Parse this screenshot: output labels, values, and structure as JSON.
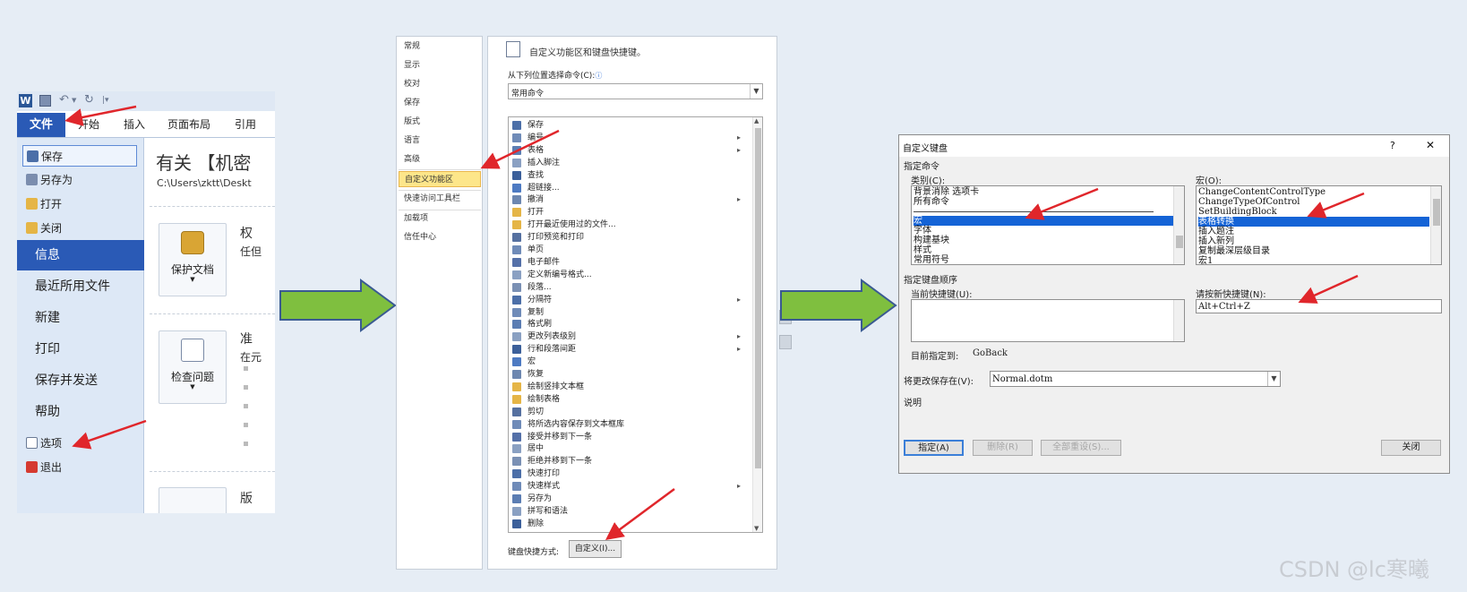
{
  "panel1": {
    "quick_access_icons": [
      "word-logo-icon",
      "save-icon",
      "undo-icon",
      "redo-icon",
      "customize-icon"
    ],
    "file_tab": "文件",
    "tabs": [
      "开始",
      "插入",
      "页面布局",
      "引用"
    ],
    "menu_small_top": [
      {
        "label": "保存",
        "icon": "save-icon"
      },
      {
        "label": "另存为",
        "icon": "save-as-icon"
      },
      {
        "label": "打开",
        "icon": "open-folder-icon"
      },
      {
        "label": "关闭",
        "icon": "close-folder-icon"
      }
    ],
    "menu_big": [
      "信息",
      "最近所用文件",
      "新建",
      "打印",
      "保存并发送",
      "帮助"
    ],
    "menu_small_bottom": [
      {
        "label": "选项",
        "icon": "options-icon"
      },
      {
        "label": "退出",
        "icon": "exit-icon"
      }
    ],
    "content_title": "有关 【机密",
    "content_path": "C:\\Users\\zktt\\Deskt",
    "section1_heading": "权",
    "section1_sub": "任但",
    "protect_label": "保护文档",
    "section2_heading": "准",
    "section2_sub": "在元",
    "check_label": "检查问题",
    "section3_heading": "版"
  },
  "panel2": {
    "nav": [
      "常规",
      "显示",
      "校对",
      "保存",
      "版式",
      "语言",
      "高级",
      "自定义功能区",
      "快速访问工具栏",
      "加载项",
      "信任中心"
    ],
    "selected_nav": "自定义功能区",
    "header": "自定义功能区和键盘快捷键。",
    "choose_label": "从下列位置选择命令(C):",
    "choose_value": "常用命令",
    "commands": [
      {
        "label": "保存",
        "sub": false
      },
      {
        "label": "编号",
        "sub": true
      },
      {
        "label": "表格",
        "sub": true
      },
      {
        "label": "插入脚注",
        "sub": false
      },
      {
        "label": "查找",
        "sub": false
      },
      {
        "label": "超链接...",
        "sub": false
      },
      {
        "label": "撤消",
        "sub": true
      },
      {
        "label": "打开",
        "sub": false
      },
      {
        "label": "打开最近使用过的文件...",
        "sub": false
      },
      {
        "label": "打印预览和打印",
        "sub": false
      },
      {
        "label": "单页",
        "sub": false
      },
      {
        "label": "电子邮件",
        "sub": false
      },
      {
        "label": "定义新编号格式...",
        "sub": false
      },
      {
        "label": "段落...",
        "sub": false
      },
      {
        "label": "分隔符",
        "sub": true
      },
      {
        "label": "复制",
        "sub": false
      },
      {
        "label": "格式刷",
        "sub": false
      },
      {
        "label": "更改列表级别",
        "sub": true
      },
      {
        "label": "行和段落间距",
        "sub": true
      },
      {
        "label": "宏",
        "sub": false
      },
      {
        "label": "恢复",
        "sub": false
      },
      {
        "label": "绘制竖排文本框",
        "sub": false
      },
      {
        "label": "绘制表格",
        "sub": false
      },
      {
        "label": "剪切",
        "sub": false
      },
      {
        "label": "将所选内容保存到文本框库",
        "sub": false
      },
      {
        "label": "接受并移到下一条",
        "sub": false
      },
      {
        "label": "居中",
        "sub": false
      },
      {
        "label": "拒绝并移到下一条",
        "sub": false
      },
      {
        "label": "快速打印",
        "sub": false
      },
      {
        "label": "快速样式",
        "sub": true
      },
      {
        "label": "另存为",
        "sub": false
      },
      {
        "label": "拼写和语法",
        "sub": false
      },
      {
        "label": "删除",
        "sub": false
      }
    ],
    "shortcut_label": "键盘快捷方式:",
    "customize_button": "自定义(I)..."
  },
  "panel3": {
    "title": "自定义键盘",
    "help": "?",
    "close_x": "✕",
    "group_commands": "指定命令",
    "category_label": "类别(C):",
    "categories": [
      "背景消除 选项卡",
      "所有命令",
      "",
      "宏",
      "字体",
      "构建基块",
      "样式",
      "常用符号"
    ],
    "category_selected": "宏",
    "macro_label": "宏(O):",
    "macros": [
      "ChangeContentControlType",
      "ChangeTypeOfControl",
      "SetBuildingBlock",
      "表格转换",
      "插入题注",
      "插入新列",
      "复制最深层级目录",
      "宏1"
    ],
    "macro_selected": "表格转换",
    "group_keys": "指定键盘顺序",
    "current_keys_label": "当前快捷键(U):",
    "new_key_label": "请按新快捷键(N):",
    "new_key_value": "Alt+Ctrl+Z",
    "assigned_to_label": "目前指定到:",
    "assigned_to_value": "GoBack",
    "save_in_label": "将更改保存在(V):",
    "save_in_value": "Normal.dotm",
    "description_label": "说明",
    "btn_assign": "指定(A)",
    "btn_remove": "删除(R)",
    "btn_reset": "全部重设(S)...",
    "btn_close": "关闭"
  },
  "watermark": "CSDN @lc寒曦",
  "colors": {
    "accent": "#2a5ab6",
    "arrow_green": "#7fbf3f",
    "arrow_outline": "#3a5a92",
    "red_arrow": "#e0262b",
    "selection": "#1463d6",
    "nav_highlight": "#fde68a"
  }
}
